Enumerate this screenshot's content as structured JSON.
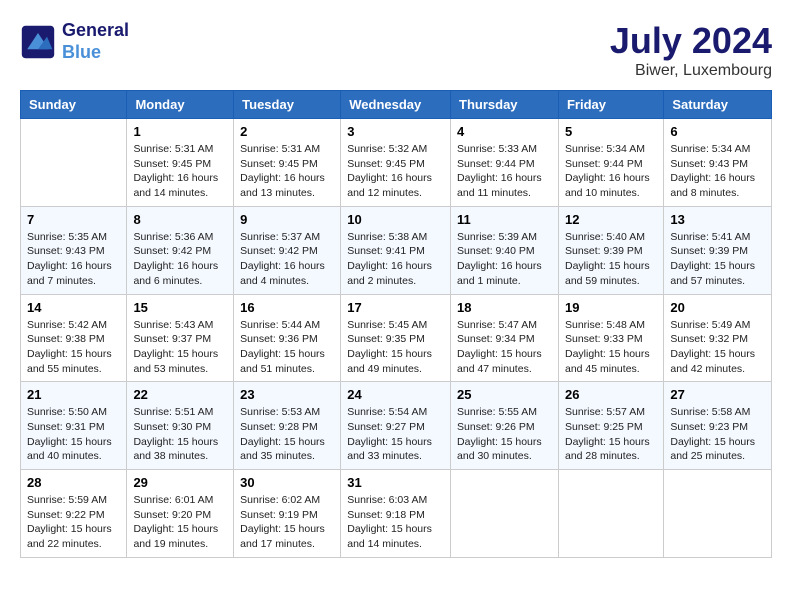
{
  "header": {
    "logo_line1": "General",
    "logo_line2": "Blue",
    "month": "July 2024",
    "location": "Biwer, Luxembourg"
  },
  "days_of_week": [
    "Sunday",
    "Monday",
    "Tuesday",
    "Wednesday",
    "Thursday",
    "Friday",
    "Saturday"
  ],
  "weeks": [
    [
      {
        "day": "",
        "info": ""
      },
      {
        "day": "1",
        "info": "Sunrise: 5:31 AM\nSunset: 9:45 PM\nDaylight: 16 hours\nand 14 minutes."
      },
      {
        "day": "2",
        "info": "Sunrise: 5:31 AM\nSunset: 9:45 PM\nDaylight: 16 hours\nand 13 minutes."
      },
      {
        "day": "3",
        "info": "Sunrise: 5:32 AM\nSunset: 9:45 PM\nDaylight: 16 hours\nand 12 minutes."
      },
      {
        "day": "4",
        "info": "Sunrise: 5:33 AM\nSunset: 9:44 PM\nDaylight: 16 hours\nand 11 minutes."
      },
      {
        "day": "5",
        "info": "Sunrise: 5:34 AM\nSunset: 9:44 PM\nDaylight: 16 hours\nand 10 minutes."
      },
      {
        "day": "6",
        "info": "Sunrise: 5:34 AM\nSunset: 9:43 PM\nDaylight: 16 hours\nand 8 minutes."
      }
    ],
    [
      {
        "day": "7",
        "info": "Sunrise: 5:35 AM\nSunset: 9:43 PM\nDaylight: 16 hours\nand 7 minutes."
      },
      {
        "day": "8",
        "info": "Sunrise: 5:36 AM\nSunset: 9:42 PM\nDaylight: 16 hours\nand 6 minutes."
      },
      {
        "day": "9",
        "info": "Sunrise: 5:37 AM\nSunset: 9:42 PM\nDaylight: 16 hours\nand 4 minutes."
      },
      {
        "day": "10",
        "info": "Sunrise: 5:38 AM\nSunset: 9:41 PM\nDaylight: 16 hours\nand 2 minutes."
      },
      {
        "day": "11",
        "info": "Sunrise: 5:39 AM\nSunset: 9:40 PM\nDaylight: 16 hours\nand 1 minute."
      },
      {
        "day": "12",
        "info": "Sunrise: 5:40 AM\nSunset: 9:39 PM\nDaylight: 15 hours\nand 59 minutes."
      },
      {
        "day": "13",
        "info": "Sunrise: 5:41 AM\nSunset: 9:39 PM\nDaylight: 15 hours\nand 57 minutes."
      }
    ],
    [
      {
        "day": "14",
        "info": "Sunrise: 5:42 AM\nSunset: 9:38 PM\nDaylight: 15 hours\nand 55 minutes."
      },
      {
        "day": "15",
        "info": "Sunrise: 5:43 AM\nSunset: 9:37 PM\nDaylight: 15 hours\nand 53 minutes."
      },
      {
        "day": "16",
        "info": "Sunrise: 5:44 AM\nSunset: 9:36 PM\nDaylight: 15 hours\nand 51 minutes."
      },
      {
        "day": "17",
        "info": "Sunrise: 5:45 AM\nSunset: 9:35 PM\nDaylight: 15 hours\nand 49 minutes."
      },
      {
        "day": "18",
        "info": "Sunrise: 5:47 AM\nSunset: 9:34 PM\nDaylight: 15 hours\nand 47 minutes."
      },
      {
        "day": "19",
        "info": "Sunrise: 5:48 AM\nSunset: 9:33 PM\nDaylight: 15 hours\nand 45 minutes."
      },
      {
        "day": "20",
        "info": "Sunrise: 5:49 AM\nSunset: 9:32 PM\nDaylight: 15 hours\nand 42 minutes."
      }
    ],
    [
      {
        "day": "21",
        "info": "Sunrise: 5:50 AM\nSunset: 9:31 PM\nDaylight: 15 hours\nand 40 minutes."
      },
      {
        "day": "22",
        "info": "Sunrise: 5:51 AM\nSunset: 9:30 PM\nDaylight: 15 hours\nand 38 minutes."
      },
      {
        "day": "23",
        "info": "Sunrise: 5:53 AM\nSunset: 9:28 PM\nDaylight: 15 hours\nand 35 minutes."
      },
      {
        "day": "24",
        "info": "Sunrise: 5:54 AM\nSunset: 9:27 PM\nDaylight: 15 hours\nand 33 minutes."
      },
      {
        "day": "25",
        "info": "Sunrise: 5:55 AM\nSunset: 9:26 PM\nDaylight: 15 hours\nand 30 minutes."
      },
      {
        "day": "26",
        "info": "Sunrise: 5:57 AM\nSunset: 9:25 PM\nDaylight: 15 hours\nand 28 minutes."
      },
      {
        "day": "27",
        "info": "Sunrise: 5:58 AM\nSunset: 9:23 PM\nDaylight: 15 hours\nand 25 minutes."
      }
    ],
    [
      {
        "day": "28",
        "info": "Sunrise: 5:59 AM\nSunset: 9:22 PM\nDaylight: 15 hours\nand 22 minutes."
      },
      {
        "day": "29",
        "info": "Sunrise: 6:01 AM\nSunset: 9:20 PM\nDaylight: 15 hours\nand 19 minutes."
      },
      {
        "day": "30",
        "info": "Sunrise: 6:02 AM\nSunset: 9:19 PM\nDaylight: 15 hours\nand 17 minutes."
      },
      {
        "day": "31",
        "info": "Sunrise: 6:03 AM\nSunset: 9:18 PM\nDaylight: 15 hours\nand 14 minutes."
      },
      {
        "day": "",
        "info": ""
      },
      {
        "day": "",
        "info": ""
      },
      {
        "day": "",
        "info": ""
      }
    ]
  ]
}
